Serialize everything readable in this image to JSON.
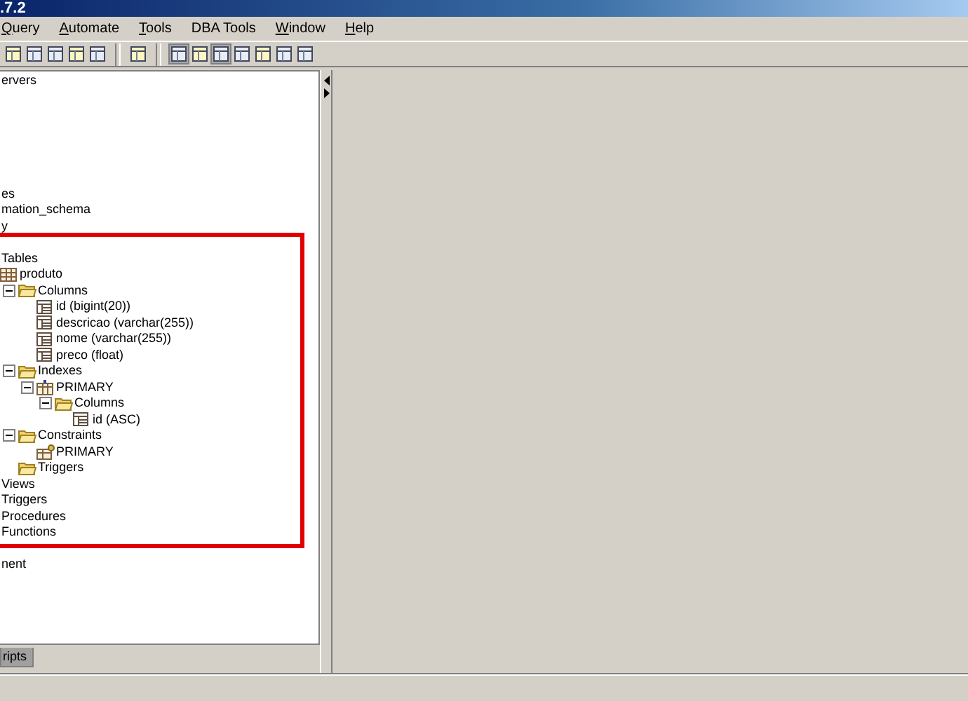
{
  "window": {
    "title": ".7.2"
  },
  "menu": [
    {
      "label": "Query",
      "mnemonic": true
    },
    {
      "label": "Automate",
      "mnemonic": true
    },
    {
      "label": "Tools",
      "mnemonic": true
    },
    {
      "label": "DBA Tools",
      "mnemonic": false
    },
    {
      "label": "Window",
      "mnemonic": true
    },
    {
      "label": "Help",
      "mnemonic": true
    }
  ],
  "toolbar": [
    {
      "kind": "tool",
      "pressed": false
    },
    {
      "kind": "tool",
      "pressed": false
    },
    {
      "kind": "tool",
      "pressed": false
    },
    {
      "kind": "tool",
      "pressed": false
    },
    {
      "kind": "tool",
      "pressed": false
    },
    {
      "kind": "separator"
    },
    {
      "kind": "tool",
      "pressed": false
    },
    {
      "kind": "separator"
    },
    {
      "kind": "tool",
      "pressed": true
    },
    {
      "kind": "tool",
      "pressed": false
    },
    {
      "kind": "tool",
      "pressed": true
    },
    {
      "kind": "tool",
      "pressed": false
    },
    {
      "kind": "tool",
      "pressed": false
    },
    {
      "kind": "tool",
      "pressed": false
    },
    {
      "kind": "tool",
      "pressed": false
    }
  ],
  "tree": [
    {
      "label": "ervers"
    },
    {
      "label": "es"
    },
    {
      "label": "mation_schema"
    },
    {
      "label": "y"
    },
    {
      "label": "Tables",
      "children": [
        {
          "label": "produto",
          "kind": "table",
          "children": [
            {
              "label": "Columns",
              "kind": "folder",
              "expanded": true,
              "children": [
                {
                  "label": "id (bigint(20))",
                  "kind": "column"
                },
                {
                  "label": "descricao (varchar(255))",
                  "kind": "column"
                },
                {
                  "label": "nome (varchar(255))",
                  "kind": "column"
                },
                {
                  "label": "preco (float)",
                  "kind": "column"
                }
              ]
            },
            {
              "label": "Indexes",
              "kind": "folder",
              "expanded": true,
              "children": [
                {
                  "label": "PRIMARY",
                  "kind": "index",
                  "expanded": true,
                  "children": [
                    {
                      "label": "Columns",
                      "kind": "folder",
                      "expanded": true,
                      "children": [
                        {
                          "label": "id (ASC)",
                          "kind": "column"
                        }
                      ]
                    }
                  ]
                }
              ]
            },
            {
              "label": "Constraints",
              "kind": "folder",
              "expanded": true,
              "children": [
                {
                  "label": "PRIMARY",
                  "kind": "key"
                }
              ]
            },
            {
              "label": "Triggers",
              "kind": "folder"
            }
          ]
        }
      ]
    },
    {
      "label": "Views"
    },
    {
      "label": "Triggers"
    },
    {
      "label": "Procedures"
    },
    {
      "label": "Functions"
    },
    {
      "label": "nent"
    }
  ],
  "bottom_tabs": [
    {
      "label": "ripts",
      "selected": true
    }
  ]
}
